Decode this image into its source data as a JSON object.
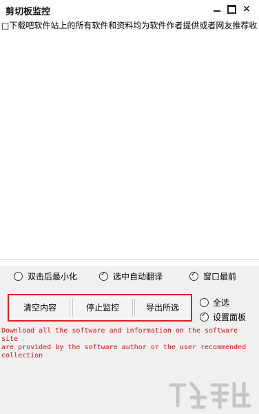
{
  "window": {
    "title": "剪切板监控",
    "minimize_icon": "minimize-icon",
    "maximize_icon": "maximize-icon",
    "close_label": "×"
  },
  "main": {
    "entries": [
      {
        "checked": false,
        "text": "□下载吧软件站上的所有软件和资料均为软件作者提供或者网友推荐收"
      }
    ]
  },
  "options": {
    "minimize_after_dblclick": {
      "label": "双击后最小化",
      "checked": false
    },
    "auto_translate": {
      "label": "选中自动翻译",
      "checked": true
    },
    "always_on_top": {
      "label": "窗口最前",
      "checked": true
    }
  },
  "controls": {
    "clear_label": "清空内容",
    "stop_label": "停止监控",
    "export_label": "导出所选",
    "select_all": {
      "label": "全选",
      "checked": false
    },
    "settings_panel": {
      "label": "设置面板",
      "checked": true
    }
  },
  "output": {
    "text": "Download all the software and information on the software site\nare provided by the software author or the user recommended\ncollection"
  },
  "colors": {
    "accent_red": "#d92121",
    "output_text": "#d01818",
    "panel_bg": "#f0f0f0"
  }
}
